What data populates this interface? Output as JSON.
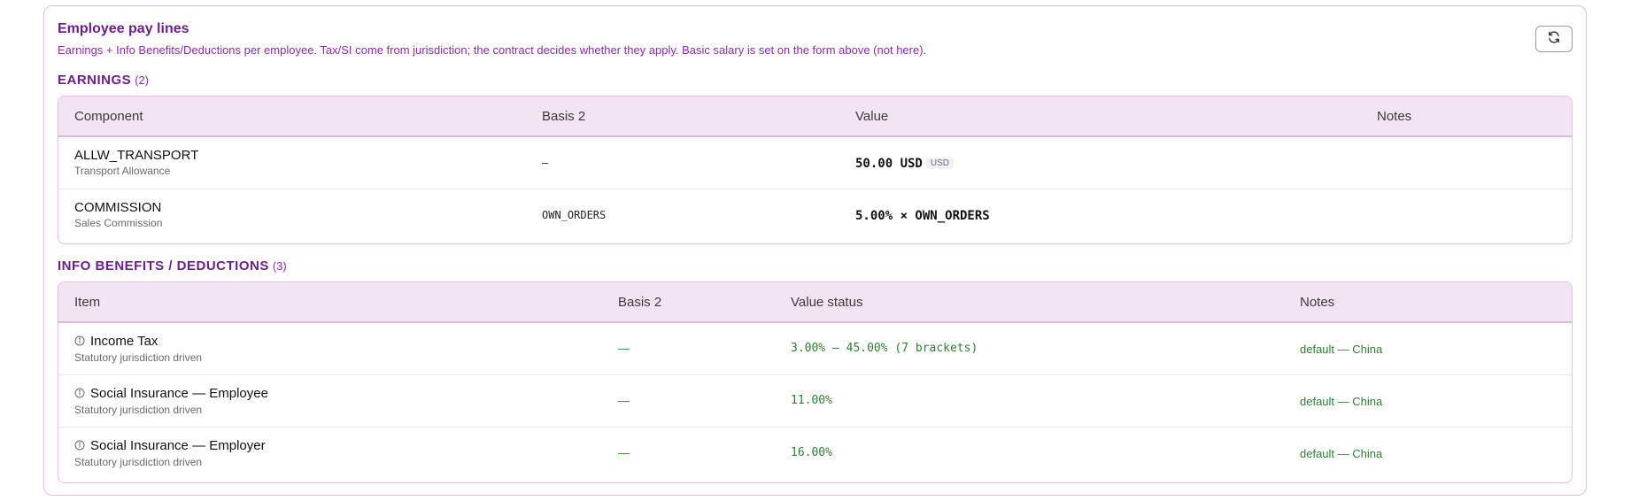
{
  "panel": {
    "title": "Employee pay lines",
    "subtitle": "Earnings + Info Benefits/Deductions per employee. Tax/SI come from jurisdiction; the contract decides whether they apply. Basic salary is set on the form above (not here).",
    "refresh_icon": "refresh-icon"
  },
  "earnings": {
    "label": "EARNINGS",
    "count": "(2)",
    "columns": [
      "Component",
      "Basis 2",
      "Value",
      "Notes"
    ],
    "rows": [
      {
        "code": "ALLW_TRANSPORT",
        "desc": "Transport Allowance",
        "basis": "–",
        "value": "50.00 USD",
        "badge": "USD",
        "notes": ""
      },
      {
        "code": "COMMISSION",
        "desc": "Sales Commission",
        "basis": "OWN_ORDERS",
        "value": "5.00% × OWN_ORDERS",
        "badge": "",
        "notes": ""
      }
    ]
  },
  "info": {
    "label": "INFO BENEFITS / DEDUCTIONS",
    "count": "(3)",
    "columns": [
      "Item",
      "Basis 2",
      "Value status",
      "Notes"
    ],
    "rows": [
      {
        "name": "Income Tax",
        "desc": "Statutory jurisdiction driven",
        "basis": "—",
        "value": "3.00% – 45.00% (7 brackets)",
        "notes": "default — China"
      },
      {
        "name": "Social Insurance — Employee",
        "desc": "Statutory jurisdiction driven",
        "basis": "—",
        "value": "11.00%",
        "notes": "default — China"
      },
      {
        "name": "Social Insurance — Employer",
        "desc": "Statutory jurisdiction driven",
        "basis": "—",
        "value": "16.00%",
        "notes": "default — China"
      }
    ]
  },
  "colors": {
    "accent": "#6b1f8a",
    "header_bg": "#f3e4f4",
    "status_green": "#2e7d32"
  }
}
